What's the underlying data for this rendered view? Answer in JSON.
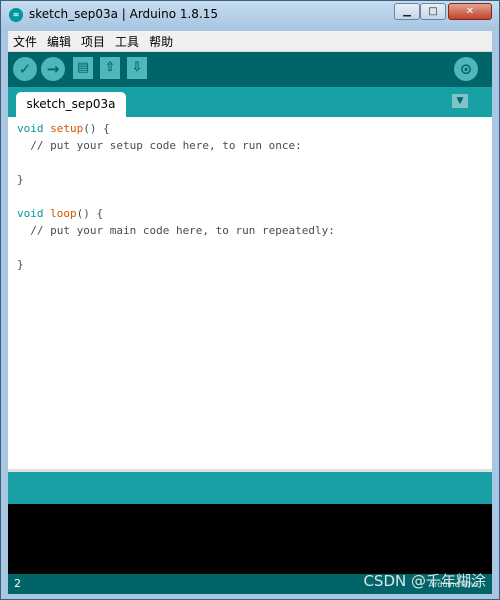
{
  "window": {
    "title": "sketch_sep03a | Arduino 1.8.15",
    "app_icon": "∞",
    "minimize_symbol": "▁",
    "maximize_symbol": "□",
    "close_symbol": "✕"
  },
  "menu": {
    "items": [
      "文件",
      "编辑",
      "项目",
      "工具",
      "帮助"
    ]
  },
  "toolbar": {
    "icons": [
      "verify-icon",
      "upload-icon",
      "new-icon",
      "open-icon",
      "save-icon",
      "serial-monitor-icon"
    ],
    "verify_symbol": "✓",
    "upload_symbol": "→",
    "new_symbol": "▤",
    "open_symbol": "⇧",
    "save_symbol": "⇩",
    "monitor_symbol": "⊙"
  },
  "tabs": {
    "active": "sketch_sep03a",
    "menu_symbol": "▼"
  },
  "editor": {
    "setup_kw": "void",
    "setup_fn": "setup",
    "setup_rest": "() {",
    "setup_comment": "  // put your setup code here, to run once:",
    "close1": "}",
    "loop_kw": "void",
    "loop_fn": "loop",
    "loop_rest": "() {",
    "loop_comment": "  // put your main code here, to run repeatedly:",
    "close2": "}"
  },
  "footer": {
    "line_number": "2",
    "board": "Arduino Uno"
  },
  "overlay": {
    "watermark": "CSDN @千年糊涂"
  },
  "colors": {
    "toolbar": "#006468",
    "tabbar": "#17a1a5",
    "keyword": "#00979c",
    "function": "#d35400"
  }
}
